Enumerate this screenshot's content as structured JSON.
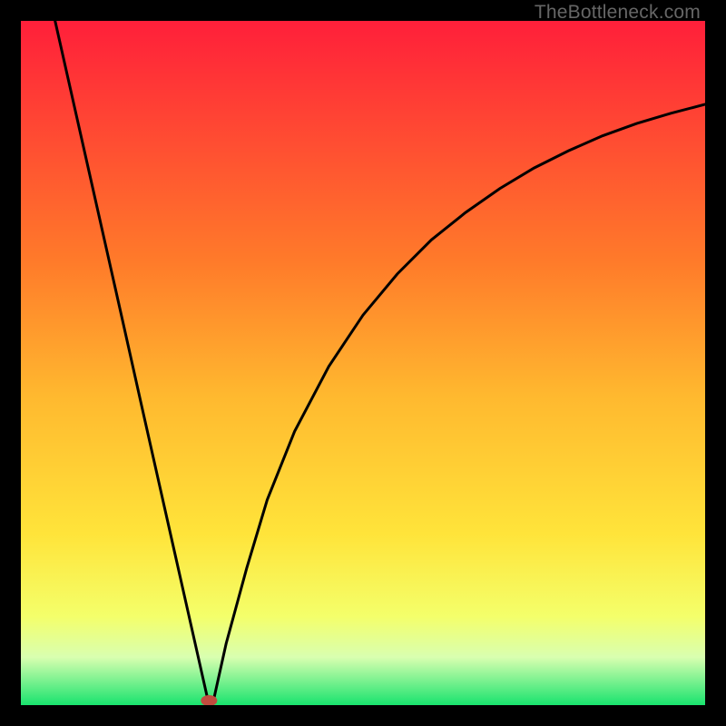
{
  "watermark": "TheBottleneck.com",
  "chart_data": {
    "type": "line",
    "title": "",
    "xlabel": "",
    "ylabel": "",
    "xlim": [
      0,
      100
    ],
    "ylim": [
      0,
      100
    ],
    "gradient_stops": [
      {
        "offset": 0,
        "color": "#ff1f3a"
      },
      {
        "offset": 35,
        "color": "#ff7a2a"
      },
      {
        "offset": 55,
        "color": "#ffb92f"
      },
      {
        "offset": 75,
        "color": "#ffe43a"
      },
      {
        "offset": 87,
        "color": "#f4ff6a"
      },
      {
        "offset": 93,
        "color": "#d9ffb0"
      },
      {
        "offset": 100,
        "color": "#19e36e"
      }
    ],
    "series": [
      {
        "name": "curve-left",
        "x": [
          5.0,
          7.5,
          10.0,
          12.5,
          15.0,
          17.5,
          20.0,
          22.5,
          25.0,
          27.5
        ],
        "values": [
          100.0,
          88.9,
          77.8,
          66.7,
          55.6,
          44.4,
          33.3,
          22.2,
          11.1,
          0.0
        ]
      },
      {
        "name": "curve-right",
        "x": [
          28.0,
          30.0,
          33.0,
          36.0,
          40.0,
          45.0,
          50.0,
          55.0,
          60.0,
          65.0,
          70.0,
          75.0,
          80.0,
          85.0,
          90.0,
          95.0,
          100.0
        ],
        "values": [
          0.0,
          9.0,
          20.0,
          30.0,
          40.0,
          49.5,
          57.0,
          63.0,
          68.0,
          72.0,
          75.5,
          78.5,
          81.0,
          83.2,
          85.0,
          86.5,
          87.8
        ]
      }
    ],
    "marker": {
      "x": 27.5,
      "y": 0.0,
      "color": "#c14c3f"
    }
  }
}
